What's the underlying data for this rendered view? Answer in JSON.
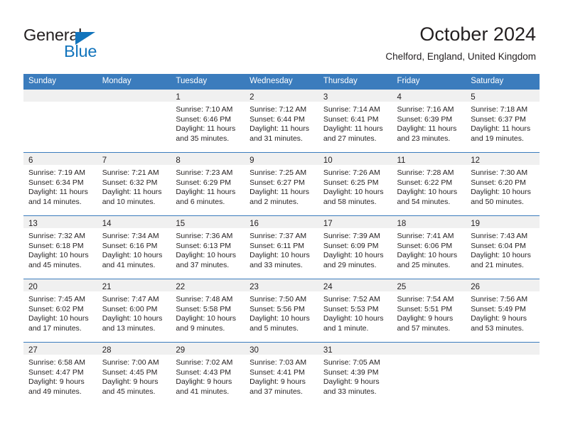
{
  "logo": {
    "word_top": "General",
    "word_bottom": "Blue",
    "triangle_color": "#1274bc",
    "text_color": "#231f20"
  },
  "header": {
    "title": "October 2024",
    "subtitle": "Chelford, England, United Kingdom"
  },
  "colors": {
    "header_blue": "#3b7cbd",
    "daynum_band": "#f0f0f0",
    "text": "#231f20",
    "logo_blue": "#1274bc"
  },
  "weekday_headers": [
    "Sunday",
    "Monday",
    "Tuesday",
    "Wednesday",
    "Thursday",
    "Friday",
    "Saturday"
  ],
  "weeks": [
    [
      {
        "day": "",
        "empty": true,
        "sunrise": "",
        "sunset": "",
        "daylight": ""
      },
      {
        "day": "",
        "empty": true,
        "sunrise": "",
        "sunset": "",
        "daylight": ""
      },
      {
        "day": "1",
        "empty": false,
        "sunrise": "Sunrise: 7:10 AM",
        "sunset": "Sunset: 6:46 PM",
        "daylight": "Daylight: 11 hours and 35 minutes."
      },
      {
        "day": "2",
        "empty": false,
        "sunrise": "Sunrise: 7:12 AM",
        "sunset": "Sunset: 6:44 PM",
        "daylight": "Daylight: 11 hours and 31 minutes."
      },
      {
        "day": "3",
        "empty": false,
        "sunrise": "Sunrise: 7:14 AM",
        "sunset": "Sunset: 6:41 PM",
        "daylight": "Daylight: 11 hours and 27 minutes."
      },
      {
        "day": "4",
        "empty": false,
        "sunrise": "Sunrise: 7:16 AM",
        "sunset": "Sunset: 6:39 PM",
        "daylight": "Daylight: 11 hours and 23 minutes."
      },
      {
        "day": "5",
        "empty": false,
        "sunrise": "Sunrise: 7:18 AM",
        "sunset": "Sunset: 6:37 PM",
        "daylight": "Daylight: 11 hours and 19 minutes."
      }
    ],
    [
      {
        "day": "6",
        "empty": false,
        "sunrise": "Sunrise: 7:19 AM",
        "sunset": "Sunset: 6:34 PM",
        "daylight": "Daylight: 11 hours and 14 minutes."
      },
      {
        "day": "7",
        "empty": false,
        "sunrise": "Sunrise: 7:21 AM",
        "sunset": "Sunset: 6:32 PM",
        "daylight": "Daylight: 11 hours and 10 minutes."
      },
      {
        "day": "8",
        "empty": false,
        "sunrise": "Sunrise: 7:23 AM",
        "sunset": "Sunset: 6:29 PM",
        "daylight": "Daylight: 11 hours and 6 minutes."
      },
      {
        "day": "9",
        "empty": false,
        "sunrise": "Sunrise: 7:25 AM",
        "sunset": "Sunset: 6:27 PM",
        "daylight": "Daylight: 11 hours and 2 minutes."
      },
      {
        "day": "10",
        "empty": false,
        "sunrise": "Sunrise: 7:26 AM",
        "sunset": "Sunset: 6:25 PM",
        "daylight": "Daylight: 10 hours and 58 minutes."
      },
      {
        "day": "11",
        "empty": false,
        "sunrise": "Sunrise: 7:28 AM",
        "sunset": "Sunset: 6:22 PM",
        "daylight": "Daylight: 10 hours and 54 minutes."
      },
      {
        "day": "12",
        "empty": false,
        "sunrise": "Sunrise: 7:30 AM",
        "sunset": "Sunset: 6:20 PM",
        "daylight": "Daylight: 10 hours and 50 minutes."
      }
    ],
    [
      {
        "day": "13",
        "empty": false,
        "sunrise": "Sunrise: 7:32 AM",
        "sunset": "Sunset: 6:18 PM",
        "daylight": "Daylight: 10 hours and 45 minutes."
      },
      {
        "day": "14",
        "empty": false,
        "sunrise": "Sunrise: 7:34 AM",
        "sunset": "Sunset: 6:16 PM",
        "daylight": "Daylight: 10 hours and 41 minutes."
      },
      {
        "day": "15",
        "empty": false,
        "sunrise": "Sunrise: 7:36 AM",
        "sunset": "Sunset: 6:13 PM",
        "daylight": "Daylight: 10 hours and 37 minutes."
      },
      {
        "day": "16",
        "empty": false,
        "sunrise": "Sunrise: 7:37 AM",
        "sunset": "Sunset: 6:11 PM",
        "daylight": "Daylight: 10 hours and 33 minutes."
      },
      {
        "day": "17",
        "empty": false,
        "sunrise": "Sunrise: 7:39 AM",
        "sunset": "Sunset: 6:09 PM",
        "daylight": "Daylight: 10 hours and 29 minutes."
      },
      {
        "day": "18",
        "empty": false,
        "sunrise": "Sunrise: 7:41 AM",
        "sunset": "Sunset: 6:06 PM",
        "daylight": "Daylight: 10 hours and 25 minutes."
      },
      {
        "day": "19",
        "empty": false,
        "sunrise": "Sunrise: 7:43 AM",
        "sunset": "Sunset: 6:04 PM",
        "daylight": "Daylight: 10 hours and 21 minutes."
      }
    ],
    [
      {
        "day": "20",
        "empty": false,
        "sunrise": "Sunrise: 7:45 AM",
        "sunset": "Sunset: 6:02 PM",
        "daylight": "Daylight: 10 hours and 17 minutes."
      },
      {
        "day": "21",
        "empty": false,
        "sunrise": "Sunrise: 7:47 AM",
        "sunset": "Sunset: 6:00 PM",
        "daylight": "Daylight: 10 hours and 13 minutes."
      },
      {
        "day": "22",
        "empty": false,
        "sunrise": "Sunrise: 7:48 AM",
        "sunset": "Sunset: 5:58 PM",
        "daylight": "Daylight: 10 hours and 9 minutes."
      },
      {
        "day": "23",
        "empty": false,
        "sunrise": "Sunrise: 7:50 AM",
        "sunset": "Sunset: 5:56 PM",
        "daylight": "Daylight: 10 hours and 5 minutes."
      },
      {
        "day": "24",
        "empty": false,
        "sunrise": "Sunrise: 7:52 AM",
        "sunset": "Sunset: 5:53 PM",
        "daylight": "Daylight: 10 hours and 1 minute."
      },
      {
        "day": "25",
        "empty": false,
        "sunrise": "Sunrise: 7:54 AM",
        "sunset": "Sunset: 5:51 PM",
        "daylight": "Daylight: 9 hours and 57 minutes."
      },
      {
        "day": "26",
        "empty": false,
        "sunrise": "Sunrise: 7:56 AM",
        "sunset": "Sunset: 5:49 PM",
        "daylight": "Daylight: 9 hours and 53 minutes."
      }
    ],
    [
      {
        "day": "27",
        "empty": false,
        "sunrise": "Sunrise: 6:58 AM",
        "sunset": "Sunset: 4:47 PM",
        "daylight": "Daylight: 9 hours and 49 minutes."
      },
      {
        "day": "28",
        "empty": false,
        "sunrise": "Sunrise: 7:00 AM",
        "sunset": "Sunset: 4:45 PM",
        "daylight": "Daylight: 9 hours and 45 minutes."
      },
      {
        "day": "29",
        "empty": false,
        "sunrise": "Sunrise: 7:02 AM",
        "sunset": "Sunset: 4:43 PM",
        "daylight": "Daylight: 9 hours and 41 minutes."
      },
      {
        "day": "30",
        "empty": false,
        "sunrise": "Sunrise: 7:03 AM",
        "sunset": "Sunset: 4:41 PM",
        "daylight": "Daylight: 9 hours and 37 minutes."
      },
      {
        "day": "31",
        "empty": false,
        "sunrise": "Sunrise: 7:05 AM",
        "sunset": "Sunset: 4:39 PM",
        "daylight": "Daylight: 9 hours and 33 minutes."
      },
      {
        "day": "",
        "empty": true,
        "sunrise": "",
        "sunset": "",
        "daylight": ""
      },
      {
        "day": "",
        "empty": true,
        "sunrise": "",
        "sunset": "",
        "daylight": ""
      }
    ]
  ]
}
